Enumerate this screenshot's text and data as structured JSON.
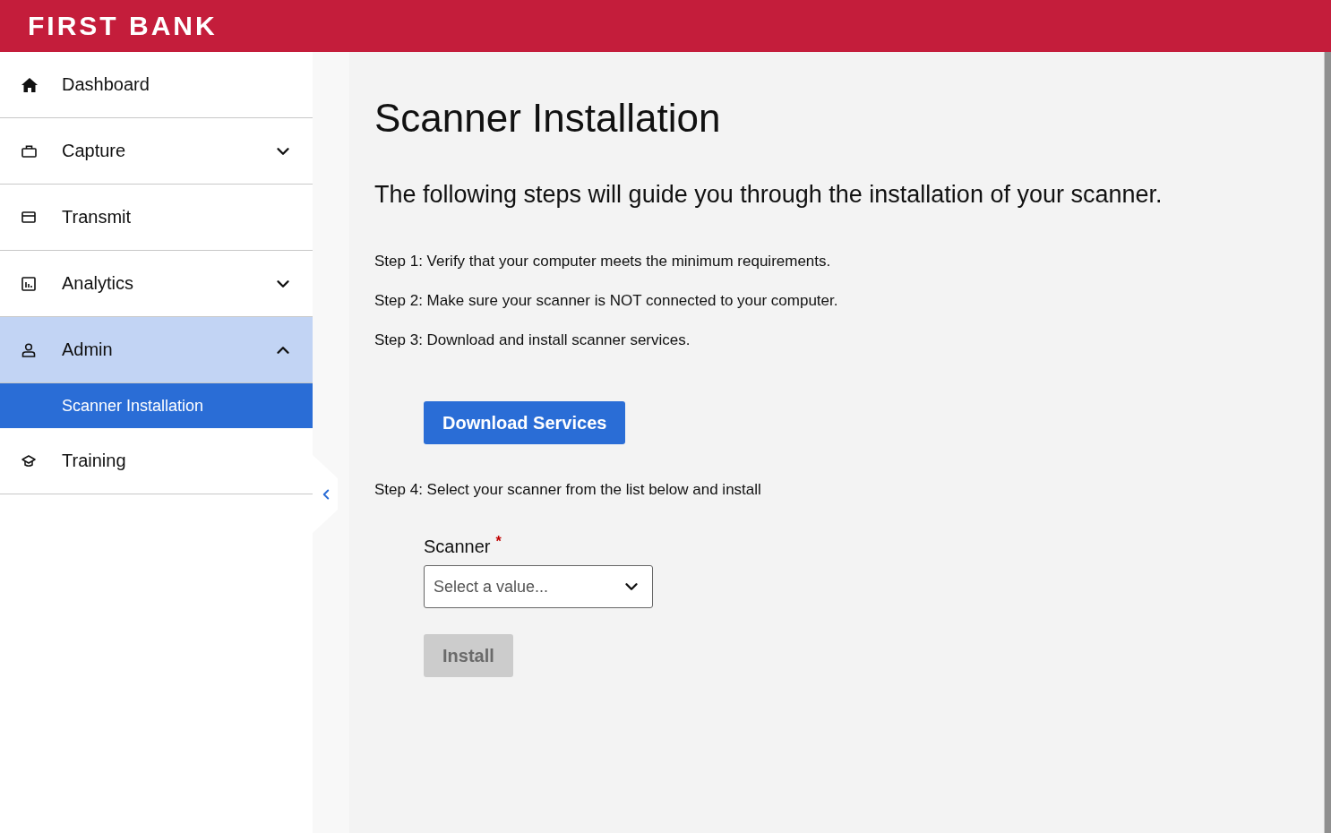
{
  "header": {
    "logo": "FIRST BANK"
  },
  "sidebar": {
    "items": [
      {
        "kind": "link",
        "label": "Dashboard",
        "selected": false
      },
      {
        "kind": "group",
        "label": "Capture",
        "selected": false,
        "expanded": false
      },
      {
        "kind": "link",
        "label": "Transmit",
        "selected": false
      },
      {
        "kind": "group",
        "label": "Analytics",
        "selected": false,
        "expanded": false
      },
      {
        "kind": "group",
        "label": "Admin",
        "selected": true,
        "expanded": true,
        "children": [
          {
            "label": "Scanner Installation",
            "selected": true
          }
        ]
      },
      {
        "kind": "link",
        "label": "Training",
        "selected": false
      }
    ]
  },
  "main": {
    "title": "Scanner Installation",
    "intro": "The following steps will guide you through the installation of your scanner.",
    "steps": [
      "Step 1: Verify that your computer meets the minimum requirements.",
      "Step 2: Make sure your scanner is NOT connected to your computer.",
      "Step 3: Download and install scanner services."
    ],
    "download_button": {
      "label": "Download Services",
      "disabled": false
    },
    "step_4": "Step 4: Select your scanner from the list below and install",
    "scanner_field": {
      "label": "Scanner",
      "required_mark": "*",
      "placeholder": "Select a value..."
    },
    "install_button": {
      "label": "Install",
      "disabled": true
    }
  }
}
